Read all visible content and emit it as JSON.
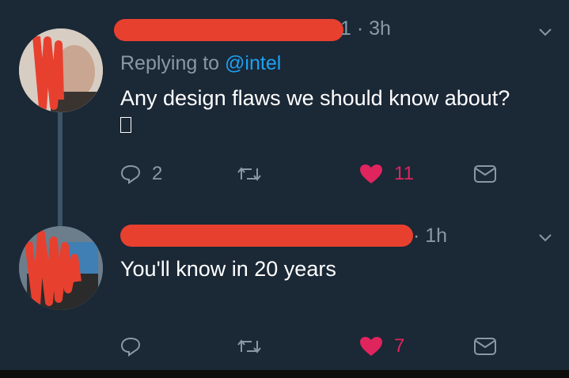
{
  "tweets": [
    {
      "header_visible": "1 · 3h",
      "replying_label": "Replying to",
      "replying_mention": "@intel",
      "text": "Any design flaws we should know about?",
      "glyph": "▯",
      "actions": {
        "reply_count": "2",
        "retweet_count": "",
        "like_count": "11",
        "dm": ""
      },
      "liked": true
    },
    {
      "header_visible": "· 1h",
      "text": "You'll know in 20 years",
      "actions": {
        "reply_count": "",
        "retweet_count": "",
        "like_count": "7",
        "dm": ""
      },
      "liked": true
    }
  ],
  "icons": {
    "reply": "reply-icon",
    "retweet": "retweet-icon",
    "like": "heart-icon",
    "dm": "envelope-icon",
    "menu": "chevron-down-icon"
  },
  "colors": {
    "background": "#1b2836",
    "secondary_text": "#8899a6",
    "link": "#1da1f2",
    "like": "#e0245e",
    "redaction": "#e8402f"
  }
}
